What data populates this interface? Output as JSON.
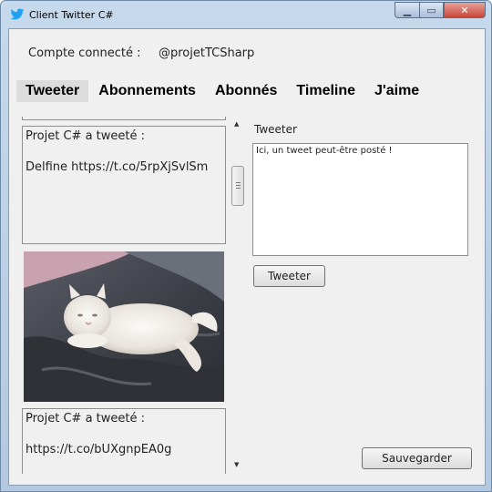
{
  "window": {
    "title": "Client Twitter C#"
  },
  "account": {
    "label": "Compte connecté :",
    "value": "@projetTCSharp"
  },
  "tabs": [
    {
      "label": "Tweeter"
    },
    {
      "label": "Abonnements"
    },
    {
      "label": "Abonnés"
    },
    {
      "label": "Timeline"
    },
    {
      "label": "J'aime"
    }
  ],
  "feed": {
    "items": [
      {
        "text": "Projet C# a tweeté :\n\nDelfine https://t.co/5rpXjSvlSm"
      },
      {
        "text": "Projet C# a tweeté :\n\nhttps://t.co/bUXgnpEA0g"
      }
    ]
  },
  "compose": {
    "label": "Tweeter",
    "value": "Ici, un tweet peut-être posté !",
    "button": "Tweeter"
  },
  "save": {
    "label": "Sauvegarder"
  },
  "colors": {
    "accent": "#1da1f2",
    "background": "#f0f0f0"
  }
}
